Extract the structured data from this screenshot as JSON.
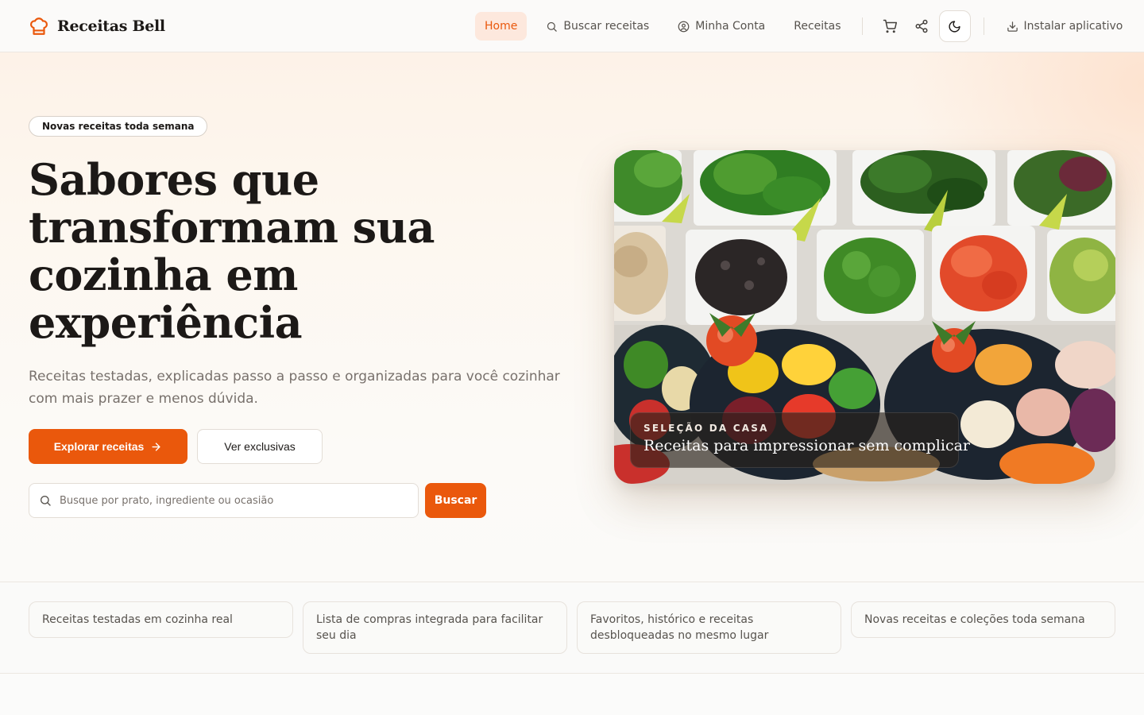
{
  "brand": {
    "name": "Receitas Bell",
    "icon": "chef-hat-icon",
    "accent": "#ea580c"
  },
  "nav": {
    "home": "Home",
    "search": "Buscar receitas",
    "account": "Minha Conta",
    "recipes": "Receitas",
    "install": "Instalar aplicativo"
  },
  "hero": {
    "pill": "Novas receitas toda semana",
    "title": "Sabores que transformam sua cozinha em experiência",
    "subtitle": "Receitas testadas, explicadas passo a passo e organizadas para você cozinhar com mais prazer e menos dúvida.",
    "primary_cta": "Explorar receitas",
    "secondary_cta": "Ver exclusivas",
    "search_placeholder": "Busque por prato, ingrediente ou ocasião",
    "search_button": "Buscar"
  },
  "feature": {
    "kicker": "SELEÇÃO DA CASA",
    "title": "Receitas para impressionar sem complicar"
  },
  "benefits": [
    "Receitas testadas em cozinha real",
    "Lista de compras integrada para facilitar seu dia",
    "Favoritos, histórico e receitas desbloqueadas no mesmo lugar",
    "Novas receitas e coleções toda semana"
  ]
}
